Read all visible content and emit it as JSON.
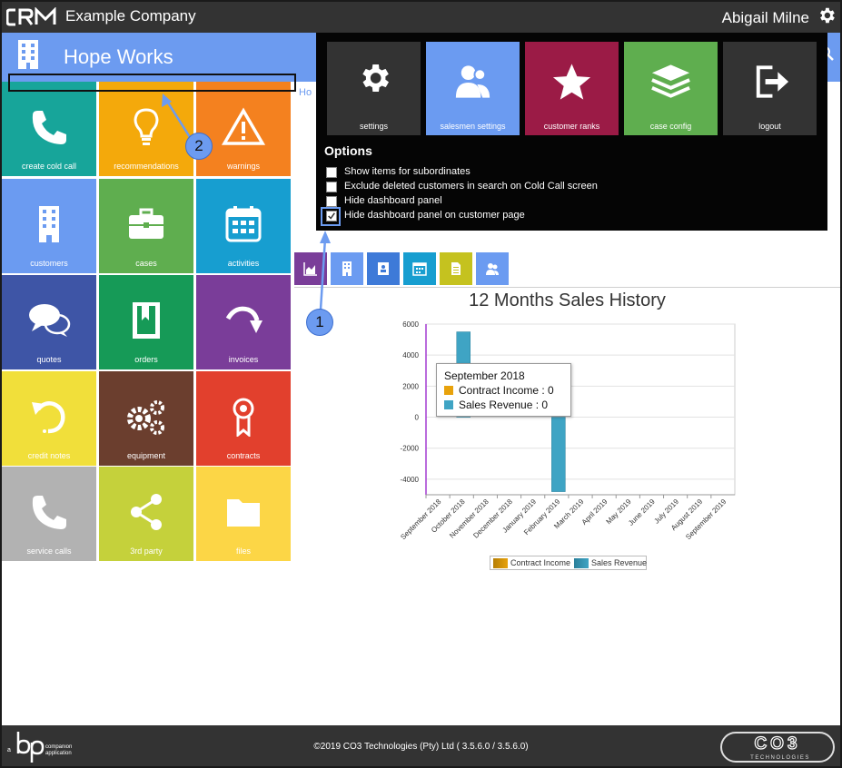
{
  "topbar": {
    "company": "Example Company",
    "user": "Abigail Milne"
  },
  "header": {
    "title": "Hope Works",
    "breadcrumb": "Ho"
  },
  "tiles": [
    {
      "label": "create cold call",
      "color": "#17a59a",
      "icon": "phone-icon"
    },
    {
      "label": "recommendations",
      "color": "#f4a90b",
      "icon": "lightbulb-icon"
    },
    {
      "label": "warnings",
      "color": "#f4811f",
      "icon": "warning-icon"
    },
    {
      "label": "customers",
      "color": "#6b9bf1",
      "icon": "building-icon"
    },
    {
      "label": "cases",
      "color": "#5fae4f",
      "icon": "briefcase-icon"
    },
    {
      "label": "activities",
      "color": "#179ed0",
      "icon": "calendar-icon"
    },
    {
      "label": "quotes",
      "color": "#3e55a6",
      "icon": "speech-bubbles-icon"
    },
    {
      "label": "orders",
      "color": "#169a57",
      "icon": "book-icon"
    },
    {
      "label": "invoices",
      "color": "#7a3d99",
      "icon": "redo-arrow-icon"
    },
    {
      "label": "credit notes",
      "color": "#f1df3a",
      "icon": "undo-arrow-icon"
    },
    {
      "label": "equipment",
      "color": "#6b3e2e",
      "icon": "gears-icon"
    },
    {
      "label": "contracts",
      "color": "#e2402d",
      "icon": "award-icon"
    },
    {
      "label": "service calls",
      "color": "#b2b2b2",
      "icon": "phone-icon"
    },
    {
      "label": "3rd party",
      "color": "#c5d13b",
      "icon": "share-icon"
    },
    {
      "label": "files",
      "color": "#fcd646",
      "icon": "folder-icon"
    }
  ],
  "options_menu": {
    "tiles": [
      {
        "label": "settings",
        "color": "#333333",
        "icon": "gear-icon"
      },
      {
        "label": "salesmen settings",
        "color": "#6b9bf1",
        "icon": "users-icon"
      },
      {
        "label": "customer ranks",
        "color": "#9b1b46",
        "icon": "star-icon"
      },
      {
        "label": "case config",
        "color": "#5fae4f",
        "icon": "layers-icon"
      },
      {
        "label": "logout",
        "color": "#333333",
        "icon": "logout-icon"
      }
    ],
    "title": "Options",
    "checkboxes": [
      {
        "label": "Show items for subordinates",
        "checked": false
      },
      {
        "label": "Exclude deleted customers in search on Cold Call screen",
        "checked": false
      },
      {
        "label": "Hide dashboard panel",
        "checked": false
      },
      {
        "label": "Hide dashboard panel on customer page",
        "checked": true
      }
    ]
  },
  "dashboard_tabs": [
    {
      "icon": "area-chart-icon",
      "color": "#7a3d99"
    },
    {
      "icon": "building-icon",
      "color": "#6b9bf1"
    },
    {
      "icon": "contacts-icon",
      "color": "#3e7ad8"
    },
    {
      "icon": "calendar-icon",
      "color": "#179ed0"
    },
    {
      "icon": "document-icon",
      "color": "#c5c21f"
    },
    {
      "icon": "users-icon",
      "color": "#6b9bf1"
    }
  ],
  "chart_data": {
    "type": "bar",
    "title": "12 Months Sales History",
    "categories": [
      "September 2018",
      "October 2018",
      "November 2018",
      "December 2018",
      "January 2019",
      "February 2019",
      "March 2019",
      "April 2019",
      "May 2019",
      "June 2019",
      "July 2019",
      "August 2019",
      "September 2019"
    ],
    "series": [
      {
        "name": "Contract Income",
        "color": "#e8a20b",
        "values": [
          0,
          0,
          0,
          0,
          0,
          0,
          0,
          0,
          0,
          0,
          0,
          0,
          0
        ]
      },
      {
        "name": "Sales Revenue",
        "color": "#3fa4c4",
        "values": [
          0,
          5500,
          0,
          0,
          0,
          -4800,
          0,
          0,
          0,
          0,
          0,
          0,
          0
        ]
      }
    ],
    "ylim": [
      -5000,
      6000
    ],
    "yticks": [
      6000,
      4000,
      2000,
      0,
      -2000,
      -4000
    ],
    "grid": true,
    "legend": "bottom-center",
    "tooltip": {
      "category": "September 2018",
      "rows": [
        {
          "label": "Contract Income : 0",
          "color": "#e8a20b"
        },
        {
          "label": "Sales Revenue : 0",
          "color": "#3fa4c4"
        }
      ]
    }
  },
  "annotations": {
    "marker1": "1",
    "marker2": "2"
  },
  "footer": {
    "copyright": "©2019 CO3 Technologies (Pty) Ltd ( 3.5.6.0 / 3.5.6.0)",
    "bp_text": "companion application",
    "bp_prefix": "a",
    "co3_text": "TECHNOLOGIES"
  }
}
